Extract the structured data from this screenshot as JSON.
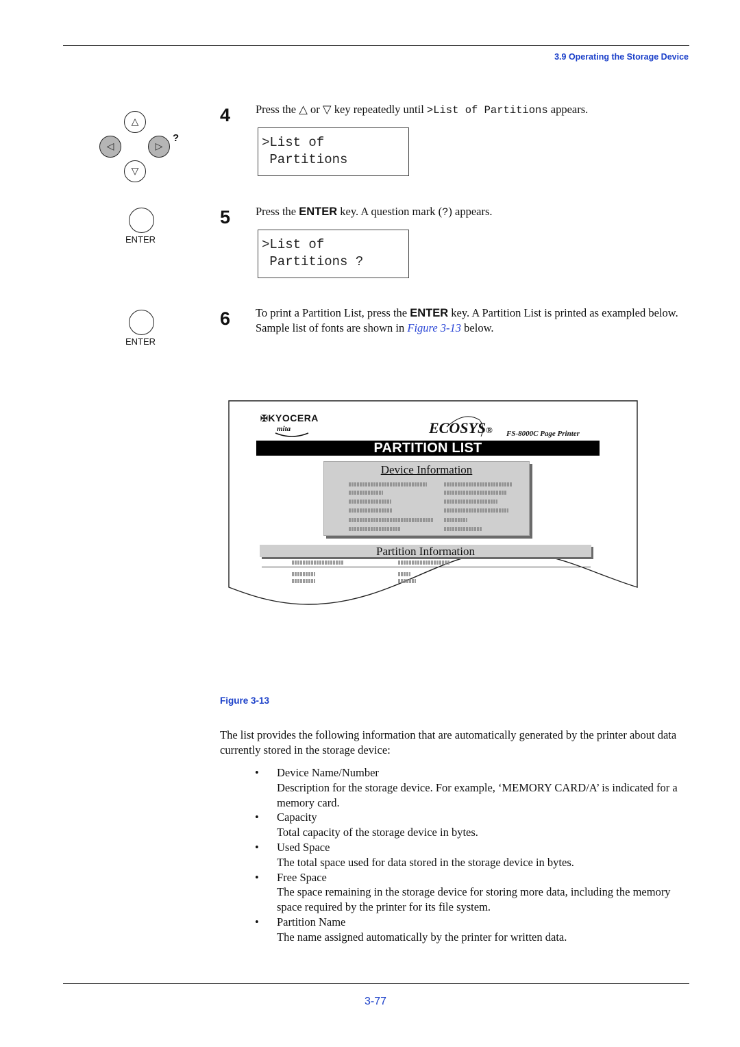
{
  "header": {
    "section_title": "3.9 Operating the Storage Device"
  },
  "keypad": {
    "up_icon": "△",
    "down_icon": "▽",
    "left_icon": "◁",
    "right_icon": "▷",
    "question_mark": "?",
    "enter_label": "ENTER"
  },
  "steps": [
    {
      "number": "4",
      "text_before": "Press the △ or ▽ key repeatedly until ",
      "code": ">List of Partitions",
      "text_after": " appears.",
      "lcd_line1": ">List of",
      "lcd_line2": " Partitions"
    },
    {
      "number": "5",
      "text_before": "Press the ",
      "key": "ENTER",
      "text_mid": " key. A question mark (",
      "code": "?",
      "text_after": ") appears.",
      "lcd_line1": ">List of",
      "lcd_line2": " Partitions ?"
    },
    {
      "number": "6",
      "text_before": "To print a Partition List, press the ",
      "key": "ENTER",
      "text_mid": " key. A Partition List is printed as exampled below. Sample list of fonts are shown in ",
      "link": "Figure 3-13",
      "text_after": " below."
    }
  ],
  "figure": {
    "brand": "KYOCERA",
    "brand_sub": "mita",
    "logo": "ECOSYS",
    "logo_mark": "®",
    "model": "FS-8000C  Page Printer",
    "banner": "PARTITION LIST",
    "device_section": "Device Information",
    "partition_section": "Partition Information",
    "caption": "Figure 3-13"
  },
  "body": {
    "intro": "The list provides the following information that are automatically generated by the printer about data currently stored in the storage device:",
    "items": [
      {
        "term": "Device Name/Number",
        "desc": "Description for the storage device. For example, ‘MEMORY CARD/A’ is indicated for a memory card."
      },
      {
        "term": "Capacity",
        "desc": "Total capacity of the storage device in bytes."
      },
      {
        "term": "Used Space",
        "desc": "The total space used for data stored in the storage device in bytes."
      },
      {
        "term": "Free Space",
        "desc": "The space remaining in the storage device for storing more data, including the memory space required by the printer for its file system."
      },
      {
        "term": "Partition Name",
        "desc": "The name assigned automatically by the printer for written data."
      }
    ]
  },
  "footer": {
    "page_number": "3-77"
  },
  "colors": {
    "accent_blue": "#1a3fc9",
    "key_grey": "#b5b5b5"
  }
}
